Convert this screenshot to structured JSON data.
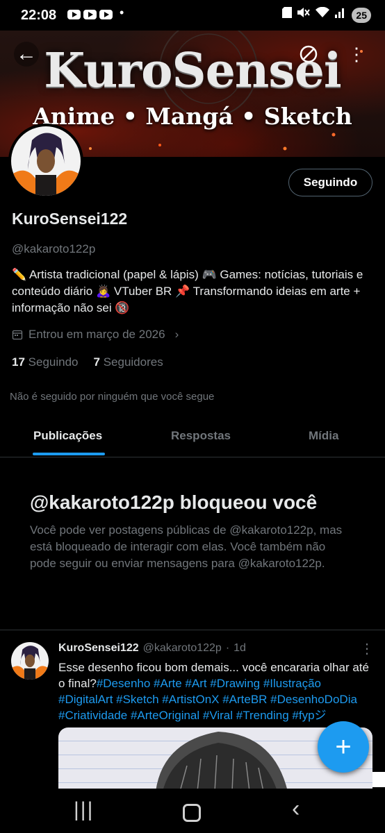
{
  "status_bar": {
    "time": "22:08",
    "dot": "•",
    "battery": "25",
    "icons": [
      "youtube-icon",
      "youtube-icon",
      "youtube-icon",
      "sd-card-icon",
      "mute-icon",
      "wifi-icon",
      "signal-icon"
    ]
  },
  "banner": {
    "title": "KuroSensei",
    "subtitle": "Anime • Mangá • Sketch"
  },
  "profile": {
    "follow_button": "Seguindo",
    "display_name": "KuroSensei122",
    "handle": "@kakaroto122p",
    "bio": "✏️ Artista tradicional (papel & lápis) 🎮 Games: notícias, tutoriais e conteúdo diário 🙇‍♀️ VTuber BR 📌 Transformando ideias em arte + informação não sei 🔞",
    "joined": "Entrou em março de 2026",
    "following_count": "17",
    "following_label": "Seguindo",
    "followers_count": "7",
    "followers_label": "Seguidores",
    "followers_note": "Não é seguido por ninguém que você segue"
  },
  "tabs": {
    "posts": "Publicações",
    "replies": "Respostas",
    "media": "Mídia",
    "active": "posts"
  },
  "blocked": {
    "title": "@kakaroto122p bloqueou você",
    "text": "Você pode ver postagens públicas de @kakaroto122p, mas está bloqueado de interagir com elas. Você também não pode seguir ou enviar mensagens para @kakaroto122p."
  },
  "post": {
    "name": "KuroSensei122",
    "handle": "@kakaroto122p",
    "sep": "·",
    "time": "1d",
    "text": "Esse desenho ficou bom demais... você encararia olhar até o final?",
    "hashtags": "#Desenho #Arte #Art #Drawing #Ilustração #DigitalArt #Sketch #ArtistOnX #ArteBR #DesenhoDoDia #Criatividade #ArteOriginal #Viral #Trending #fypジ"
  },
  "fab": {
    "label": "+"
  },
  "colors": {
    "accent": "#1d9bf0",
    "muted": "#71767b",
    "text": "#e7e9ea",
    "border": "#2f3336"
  }
}
